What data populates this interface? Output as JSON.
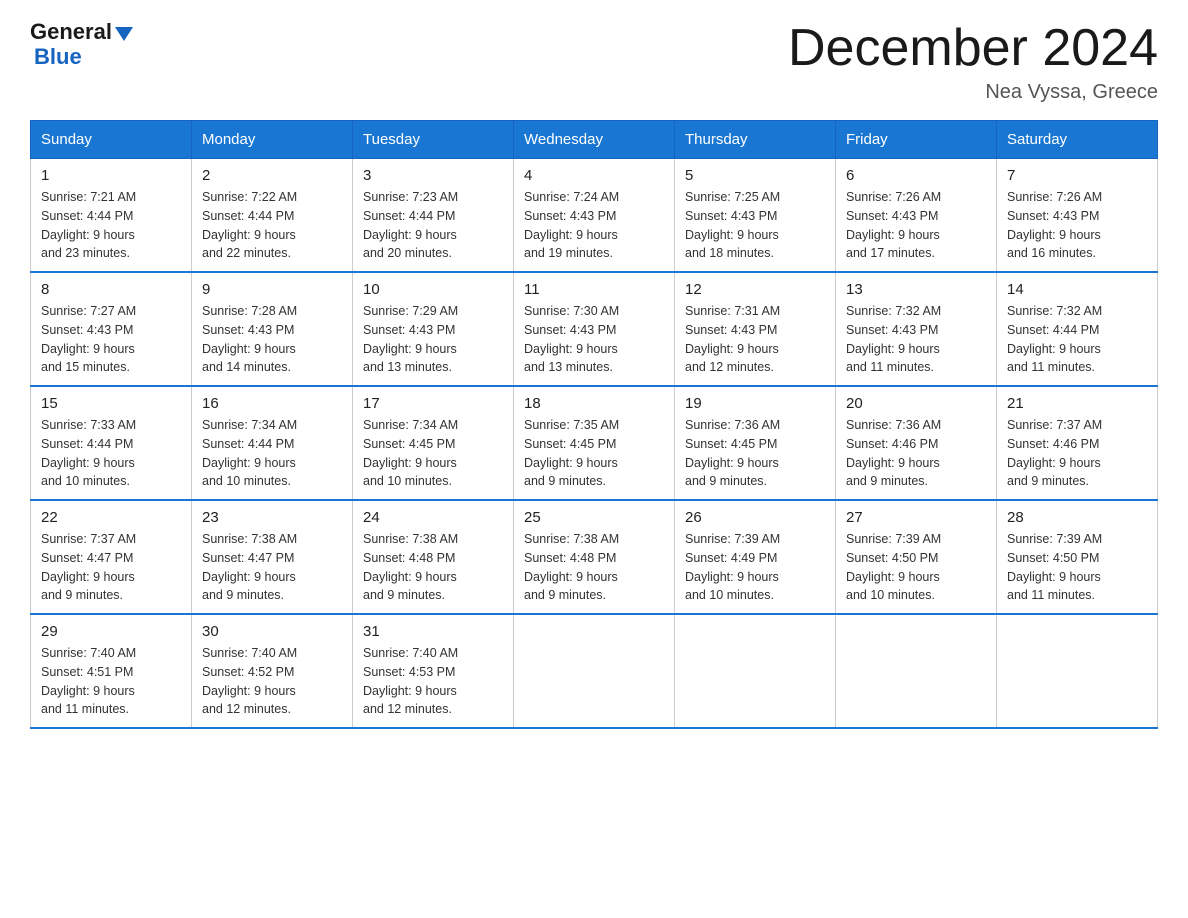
{
  "header": {
    "logo_line1": "General",
    "logo_line2": "Blue",
    "month_title": "December 2024",
    "location": "Nea Vyssa, Greece"
  },
  "days_of_week": [
    "Sunday",
    "Monday",
    "Tuesday",
    "Wednesday",
    "Thursday",
    "Friday",
    "Saturday"
  ],
  "weeks": [
    [
      {
        "day": "1",
        "sunrise": "7:21 AM",
        "sunset": "4:44 PM",
        "daylight": "9 hours and 23 minutes."
      },
      {
        "day": "2",
        "sunrise": "7:22 AM",
        "sunset": "4:44 PM",
        "daylight": "9 hours and 22 minutes."
      },
      {
        "day": "3",
        "sunrise": "7:23 AM",
        "sunset": "4:44 PM",
        "daylight": "9 hours and 20 minutes."
      },
      {
        "day": "4",
        "sunrise": "7:24 AM",
        "sunset": "4:43 PM",
        "daylight": "9 hours and 19 minutes."
      },
      {
        "day": "5",
        "sunrise": "7:25 AM",
        "sunset": "4:43 PM",
        "daylight": "9 hours and 18 minutes."
      },
      {
        "day": "6",
        "sunrise": "7:26 AM",
        "sunset": "4:43 PM",
        "daylight": "9 hours and 17 minutes."
      },
      {
        "day": "7",
        "sunrise": "7:26 AM",
        "sunset": "4:43 PM",
        "daylight": "9 hours and 16 minutes."
      }
    ],
    [
      {
        "day": "8",
        "sunrise": "7:27 AM",
        "sunset": "4:43 PM",
        "daylight": "9 hours and 15 minutes."
      },
      {
        "day": "9",
        "sunrise": "7:28 AM",
        "sunset": "4:43 PM",
        "daylight": "9 hours and 14 minutes."
      },
      {
        "day": "10",
        "sunrise": "7:29 AM",
        "sunset": "4:43 PM",
        "daylight": "9 hours and 13 minutes."
      },
      {
        "day": "11",
        "sunrise": "7:30 AM",
        "sunset": "4:43 PM",
        "daylight": "9 hours and 13 minutes."
      },
      {
        "day": "12",
        "sunrise": "7:31 AM",
        "sunset": "4:43 PM",
        "daylight": "9 hours and 12 minutes."
      },
      {
        "day": "13",
        "sunrise": "7:32 AM",
        "sunset": "4:43 PM",
        "daylight": "9 hours and 11 minutes."
      },
      {
        "day": "14",
        "sunrise": "7:32 AM",
        "sunset": "4:44 PM",
        "daylight": "9 hours and 11 minutes."
      }
    ],
    [
      {
        "day": "15",
        "sunrise": "7:33 AM",
        "sunset": "4:44 PM",
        "daylight": "9 hours and 10 minutes."
      },
      {
        "day": "16",
        "sunrise": "7:34 AM",
        "sunset": "4:44 PM",
        "daylight": "9 hours and 10 minutes."
      },
      {
        "day": "17",
        "sunrise": "7:34 AM",
        "sunset": "4:45 PM",
        "daylight": "9 hours and 10 minutes."
      },
      {
        "day": "18",
        "sunrise": "7:35 AM",
        "sunset": "4:45 PM",
        "daylight": "9 hours and 9 minutes."
      },
      {
        "day": "19",
        "sunrise": "7:36 AM",
        "sunset": "4:45 PM",
        "daylight": "9 hours and 9 minutes."
      },
      {
        "day": "20",
        "sunrise": "7:36 AM",
        "sunset": "4:46 PM",
        "daylight": "9 hours and 9 minutes."
      },
      {
        "day": "21",
        "sunrise": "7:37 AM",
        "sunset": "4:46 PM",
        "daylight": "9 hours and 9 minutes."
      }
    ],
    [
      {
        "day": "22",
        "sunrise": "7:37 AM",
        "sunset": "4:47 PM",
        "daylight": "9 hours and 9 minutes."
      },
      {
        "day": "23",
        "sunrise": "7:38 AM",
        "sunset": "4:47 PM",
        "daylight": "9 hours and 9 minutes."
      },
      {
        "day": "24",
        "sunrise": "7:38 AM",
        "sunset": "4:48 PM",
        "daylight": "9 hours and 9 minutes."
      },
      {
        "day": "25",
        "sunrise": "7:38 AM",
        "sunset": "4:48 PM",
        "daylight": "9 hours and 9 minutes."
      },
      {
        "day": "26",
        "sunrise": "7:39 AM",
        "sunset": "4:49 PM",
        "daylight": "9 hours and 10 minutes."
      },
      {
        "day": "27",
        "sunrise": "7:39 AM",
        "sunset": "4:50 PM",
        "daylight": "9 hours and 10 minutes."
      },
      {
        "day": "28",
        "sunrise": "7:39 AM",
        "sunset": "4:50 PM",
        "daylight": "9 hours and 11 minutes."
      }
    ],
    [
      {
        "day": "29",
        "sunrise": "7:40 AM",
        "sunset": "4:51 PM",
        "daylight": "9 hours and 11 minutes."
      },
      {
        "day": "30",
        "sunrise": "7:40 AM",
        "sunset": "4:52 PM",
        "daylight": "9 hours and 12 minutes."
      },
      {
        "day": "31",
        "sunrise": "7:40 AM",
        "sunset": "4:53 PM",
        "daylight": "9 hours and 12 minutes."
      },
      null,
      null,
      null,
      null
    ]
  ],
  "labels": {
    "sunrise": "Sunrise:",
    "sunset": "Sunset:",
    "daylight": "Daylight:"
  }
}
